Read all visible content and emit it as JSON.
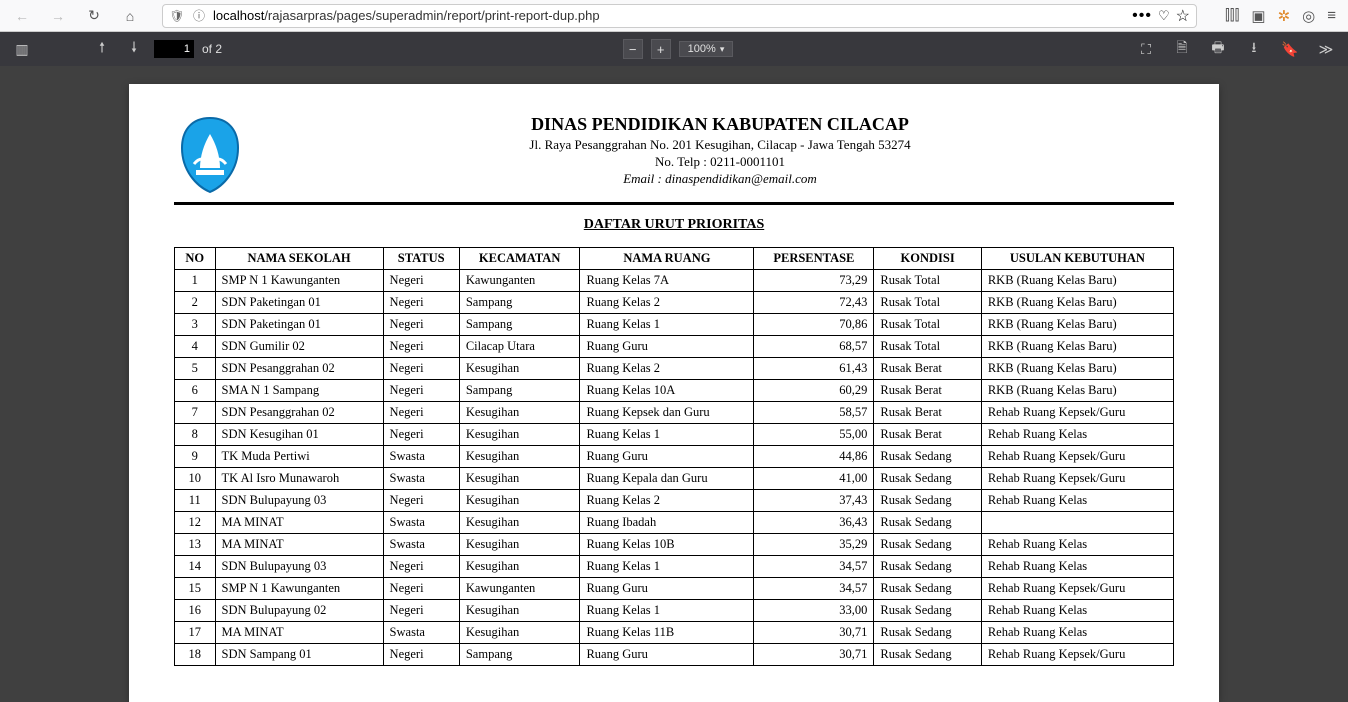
{
  "browser": {
    "url_host": "localhost",
    "url_path": "/rajasarpras/pages/superadmin/report/print-report-dup.php"
  },
  "pdf": {
    "page_current": "1",
    "page_label": "of 2",
    "zoom": "100%"
  },
  "doc": {
    "org": "DINAS PENDIDIKAN KABUPATEN CILACAP",
    "address": "Jl. Raya Pesanggrahan No. 201 Kesugihan, Cilacap - Jawa Tengah 53274",
    "phone": "No. Telp : 0211-0001101",
    "email_label": "Email :",
    "email": "dinaspendidikan@email.com",
    "title": "DAFTAR URUT PRIORITAS"
  },
  "columns": [
    "NO",
    "NAMA SEKOLAH",
    "STATUS",
    "KECAMATAN",
    "NAMA RUANG",
    "PERSENTASE",
    "KONDISI",
    "USULAN KEBUTUHAN"
  ],
  "rows": [
    {
      "no": "1",
      "sekolah": "SMP N 1 Kawunganten",
      "status": "Negeri",
      "kec": "Kawunganten",
      "ruang": "Ruang Kelas 7A",
      "pct": "73,29",
      "kondisi": "Rusak Total",
      "usulan": "RKB (Ruang Kelas Baru)"
    },
    {
      "no": "2",
      "sekolah": "SDN Paketingan 01",
      "status": "Negeri",
      "kec": "Sampang",
      "ruang": "Ruang Kelas 2",
      "pct": "72,43",
      "kondisi": "Rusak Total",
      "usulan": "RKB (Ruang Kelas Baru)"
    },
    {
      "no": "3",
      "sekolah": "SDN Paketingan 01",
      "status": "Negeri",
      "kec": "Sampang",
      "ruang": "Ruang Kelas 1",
      "pct": "70,86",
      "kondisi": "Rusak Total",
      "usulan": "RKB (Ruang Kelas Baru)"
    },
    {
      "no": "4",
      "sekolah": "SDN Gumilir 02",
      "status": "Negeri",
      "kec": "Cilacap Utara",
      "ruang": "Ruang Guru",
      "pct": "68,57",
      "kondisi": "Rusak Total",
      "usulan": "RKB (Ruang Kelas Baru)"
    },
    {
      "no": "5",
      "sekolah": "SDN Pesanggrahan 02",
      "status": "Negeri",
      "kec": "Kesugihan",
      "ruang": "Ruang Kelas 2",
      "pct": "61,43",
      "kondisi": "Rusak Berat",
      "usulan": "RKB (Ruang Kelas Baru)"
    },
    {
      "no": "6",
      "sekolah": "SMA N 1 Sampang",
      "status": "Negeri",
      "kec": "Sampang",
      "ruang": "Ruang Kelas 10A",
      "pct": "60,29",
      "kondisi": "Rusak Berat",
      "usulan": "RKB (Ruang Kelas Baru)"
    },
    {
      "no": "7",
      "sekolah": "SDN Pesanggrahan 02",
      "status": "Negeri",
      "kec": "Kesugihan",
      "ruang": "Ruang Kepsek dan Guru",
      "pct": "58,57",
      "kondisi": "Rusak Berat",
      "usulan": "Rehab Ruang Kepsek/Guru"
    },
    {
      "no": "8",
      "sekolah": "SDN Kesugihan 01",
      "status": "Negeri",
      "kec": "Kesugihan",
      "ruang": "Ruang Kelas 1",
      "pct": "55,00",
      "kondisi": "Rusak Berat",
      "usulan": "Rehab Ruang Kelas"
    },
    {
      "no": "9",
      "sekolah": "TK Muda Pertiwi",
      "status": "Swasta",
      "kec": "Kesugihan",
      "ruang": "Ruang Guru",
      "pct": "44,86",
      "kondisi": "Rusak Sedang",
      "usulan": "Rehab Ruang Kepsek/Guru"
    },
    {
      "no": "10",
      "sekolah": "TK Al Isro Munawaroh",
      "status": "Swasta",
      "kec": "Kesugihan",
      "ruang": "Ruang Kepala dan Guru",
      "pct": "41,00",
      "kondisi": "Rusak Sedang",
      "usulan": "Rehab Ruang Kepsek/Guru"
    },
    {
      "no": "11",
      "sekolah": "SDN Bulupayung 03",
      "status": "Negeri",
      "kec": "Kesugihan",
      "ruang": "Ruang Kelas 2",
      "pct": "37,43",
      "kondisi": "Rusak Sedang",
      "usulan": "Rehab Ruang Kelas"
    },
    {
      "no": "12",
      "sekolah": "MA MINAT",
      "status": "Swasta",
      "kec": "Kesugihan",
      "ruang": "Ruang Ibadah",
      "pct": "36,43",
      "kondisi": "Rusak Sedang",
      "usulan": ""
    },
    {
      "no": "13",
      "sekolah": "MA MINAT",
      "status": "Swasta",
      "kec": "Kesugihan",
      "ruang": "Ruang Kelas 10B",
      "pct": "35,29",
      "kondisi": "Rusak Sedang",
      "usulan": "Rehab Ruang Kelas"
    },
    {
      "no": "14",
      "sekolah": "SDN Bulupayung 03",
      "status": "Negeri",
      "kec": "Kesugihan",
      "ruang": "Ruang Kelas 1",
      "pct": "34,57",
      "kondisi": "Rusak Sedang",
      "usulan": "Rehab Ruang Kelas"
    },
    {
      "no": "15",
      "sekolah": "SMP N 1 Kawunganten",
      "status": "Negeri",
      "kec": "Kawunganten",
      "ruang": "Ruang Guru",
      "pct": "34,57",
      "kondisi": "Rusak Sedang",
      "usulan": "Rehab Ruang Kepsek/Guru"
    },
    {
      "no": "16",
      "sekolah": "SDN Bulupayung 02",
      "status": "Negeri",
      "kec": "Kesugihan",
      "ruang": "Ruang Kelas 1",
      "pct": "33,00",
      "kondisi": "Rusak Sedang",
      "usulan": "Rehab Ruang Kelas"
    },
    {
      "no": "17",
      "sekolah": "MA MINAT",
      "status": "Swasta",
      "kec": "Kesugihan",
      "ruang": "Ruang Kelas 11B",
      "pct": "30,71",
      "kondisi": "Rusak Sedang",
      "usulan": "Rehab Ruang Kelas"
    },
    {
      "no": "18",
      "sekolah": "SDN Sampang 01",
      "status": "Negeri",
      "kec": "Sampang",
      "ruang": "Ruang Guru",
      "pct": "30,71",
      "kondisi": "Rusak Sedang",
      "usulan": "Rehab Ruang Kepsek/Guru"
    }
  ]
}
